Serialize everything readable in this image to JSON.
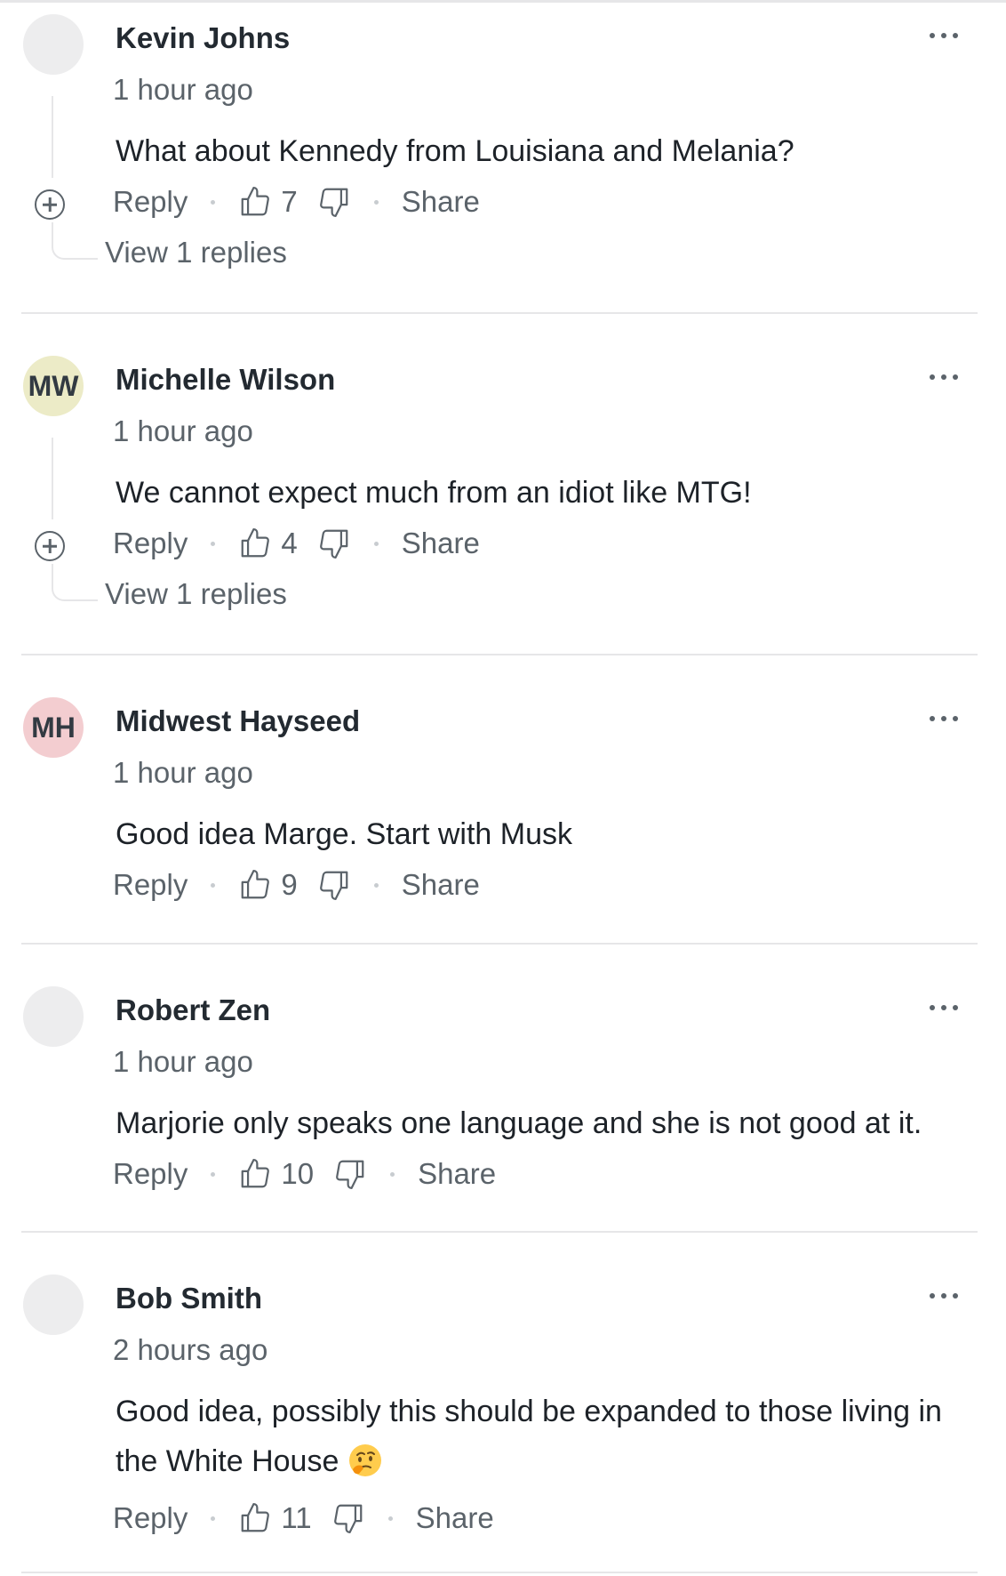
{
  "comments": [
    {
      "author": "Kevin Johns",
      "avatar_initials": "",
      "avatar_color": "#ededee",
      "time": "1 hour ago",
      "text": "What about Kennedy from Louisiana and Melania?",
      "reply_label": "Reply",
      "likes": "7",
      "share_label": "Share",
      "view_replies": "View 1 replies"
    },
    {
      "author": "Michelle Wilson",
      "avatar_initials": "MW",
      "avatar_color": "#ecebc7",
      "time": "1 hour ago",
      "text": "We cannot expect much from an idiot like MTG!",
      "reply_label": "Reply",
      "likes": "4",
      "share_label": "Share",
      "view_replies": "View 1 replies"
    },
    {
      "author": "Midwest Hayseed",
      "avatar_initials": "MH",
      "avatar_color": "#f3cdd0",
      "time": "1 hour ago",
      "text": "Good idea Marge. Start with Musk",
      "reply_label": "Reply",
      "likes": "9",
      "share_label": "Share"
    },
    {
      "author": "Robert Zen",
      "avatar_initials": "",
      "avatar_color": "#ededee",
      "time": "1 hour ago",
      "text": "Marjorie only speaks one language and she is not good at it.",
      "reply_label": "Reply",
      "likes": "10",
      "share_label": "Share"
    },
    {
      "author": "Bob Smith",
      "avatar_initials": "",
      "avatar_color": "#ededee",
      "time": "2 hours ago",
      "text": "Good idea, possibly this should be expanded to those living in the White House",
      "emoji": "thinking-face-emoji",
      "reply_label": "Reply",
      "likes": "11",
      "share_label": "Share"
    }
  ],
  "icons": {
    "like": "thumbs-up-icon",
    "dislike": "thumbs-down-icon",
    "more": "more-options-icon",
    "expand": "plus-circle-icon"
  },
  "colors": {
    "author": "#232a31",
    "meta": "#5b636a",
    "divider": "#e6e6e8"
  }
}
